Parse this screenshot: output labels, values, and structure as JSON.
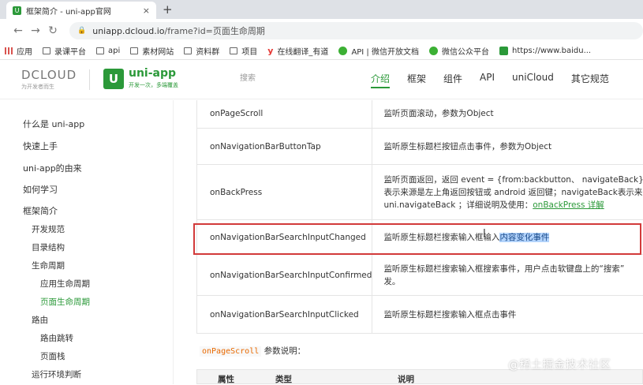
{
  "browser": {
    "tab_title": "框架简介 - uni-app官网",
    "tab_icon_letter": "U",
    "close_glyph": "×",
    "newtab_glyph": "+",
    "url_host": "uniapp.dcloud.io",
    "url_path": "/frame?id=页面生命周期",
    "bookmarks": [
      {
        "label": "应用",
        "icon": "apps-grid-icon"
      },
      {
        "label": "录课平台",
        "icon": "folder-icon"
      },
      {
        "label": "api",
        "icon": "folder-icon"
      },
      {
        "label": "素材网站",
        "icon": "folder-icon"
      },
      {
        "label": "资料群",
        "icon": "folder-icon"
      },
      {
        "label": "项目",
        "icon": "folder-icon"
      },
      {
        "label": "在线翻译_有道",
        "icon": "youdao-icon"
      },
      {
        "label": "API | 微信开放文档",
        "icon": "wechat-icon"
      },
      {
        "label": "微信公众平台",
        "icon": "wechat-icon"
      },
      {
        "label": "https://www.baidu...",
        "icon": "uniapp-icon"
      }
    ]
  },
  "header": {
    "dcloud_mark": "DCLOUD",
    "dcloud_sub": "为开发者而生",
    "uni_letter": "U",
    "uni_name": "uni-app",
    "uni_slogan": "开发一次，多端覆盖",
    "search_placeholder": "搜索",
    "nav": [
      "介绍",
      "框架",
      "组件",
      "API",
      "uniCloud",
      "其它规范"
    ]
  },
  "sidebar": {
    "items": [
      {
        "label": "什么是 uni-app",
        "level": 0
      },
      {
        "label": "快速上手",
        "level": 0
      },
      {
        "label": "uni-app的由来",
        "level": 0
      },
      {
        "label": "如何学习",
        "level": 0
      },
      {
        "label": "框架简介",
        "level": 0
      },
      {
        "label": "开发规范",
        "level": 1
      },
      {
        "label": "目录结构",
        "level": 1
      },
      {
        "label": "生命周期",
        "level": 1
      },
      {
        "label": "应用生命周期",
        "level": 2
      },
      {
        "label": "页面生命周期",
        "level": 2,
        "active": true
      },
      {
        "label": "路由",
        "level": 1
      },
      {
        "label": "路由跳转",
        "level": 2
      },
      {
        "label": "页面栈",
        "level": 2
      },
      {
        "label": "运行环境判断",
        "level": 1
      }
    ]
  },
  "events": [
    {
      "name": "onPageScroll",
      "desc": "监听页面滚动，参数为Object"
    },
    {
      "name": "onNavigationBarButtonTap",
      "desc": "监听原生标题栏按钮点击事件，参数为Object"
    },
    {
      "name": "onBackPress",
      "desc_lines": [
        "监听页面返回，返回 event = {from:backbutton、 navigateBack} ，b",
        "表示来源是左上角返回按钮或 android 返回键；navigateBack表示来",
        "uni.navigateBack ；详细说明及使用："
      ],
      "link": "onBackPress 详解"
    },
    {
      "name": "onNavigationBarSearchInputChanged",
      "desc_plain": "监听原生标题栏搜索输入框输入",
      "desc_highlight": "内容变化事件"
    },
    {
      "name": "onNavigationBarSearchInputConfirmed",
      "desc_lines": [
        "监听原生标题栏搜索输入框搜索事件，用户点击软键盘上的“搜索”",
        "发。"
      ]
    },
    {
      "name": "onNavigationBarSearchInputClicked",
      "desc": "监听原生标题栏搜索输入框点击事件"
    }
  ],
  "params": {
    "code": "onPageScroll",
    "text": " 参数说明：",
    "headers": [
      "属性",
      "类型",
      "说明"
    ]
  },
  "watermark": "@稀土掘金技术社区",
  "colors": {
    "accent": "#2b9939",
    "highlight_box": "#d23a3a",
    "selection": "#b3d4fc"
  }
}
